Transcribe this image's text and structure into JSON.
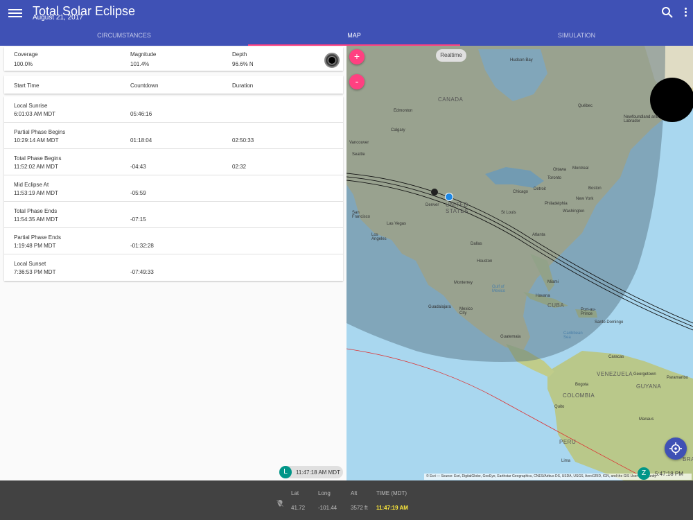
{
  "app": {
    "title": "Total Solar Eclipse",
    "subtitle": "August 21, 2017",
    "icons": {
      "menu": "menu-icon",
      "search": "search-icon",
      "more": "more-vert-icon"
    }
  },
  "tabs": [
    {
      "label": "CIRCUMSTANCES",
      "active": false
    },
    {
      "label": "MAP",
      "active": true
    },
    {
      "label": "SIMULATION",
      "active": false
    }
  ],
  "summary": {
    "coverage_label": "Coverage",
    "coverage": "100.0%",
    "magnitude_label": "Magnitude",
    "magnitude": "101.4%",
    "depth_label": "Depth",
    "depth": "96.6% N"
  },
  "table_header": {
    "start_time": "Start Time",
    "countdown": "Countdown",
    "duration": "Duration"
  },
  "events": [
    {
      "name": "Local Sunrise",
      "time": "6:01:03 AM MDT",
      "countdown": "05:46:16",
      "duration": ""
    },
    {
      "name": "Partial Phase Begins",
      "time": "10:29:14 AM MDT",
      "countdown": "01:18:04",
      "duration": "02:50:33"
    },
    {
      "name": "Total Phase Begins",
      "time": "11:52:02 AM MDT",
      "countdown": "-04:43",
      "duration": "02:32"
    },
    {
      "name": "Mid Eclipse At",
      "time": "11:53:19 AM MDT",
      "countdown": "-05:59",
      "duration": ""
    },
    {
      "name": "Total Phase Ends",
      "time": "11:54:35 AM MDT",
      "countdown": "-07:15",
      "duration": ""
    },
    {
      "name": "Partial Phase Ends",
      "time": "1:19:48 PM MDT",
      "countdown": "-01:32:28",
      "duration": ""
    },
    {
      "name": "Local Sunset",
      "time": "7:36:53 PM MDT",
      "countdown": "-07:49:33",
      "duration": ""
    }
  ],
  "local_chip": {
    "letter": "L",
    "time": "11:47:18 AM MDT"
  },
  "map": {
    "realtime_label": "Realtime",
    "zoom_in": "+",
    "zoom_out": "-",
    "z_chip": {
      "letter": "Z",
      "time": "5:47:18 PM"
    },
    "attribution": "© Esri — Source: Esri, DigitalGlobe, GeoEye, Earthstar Geographics, CNES/Airbus DS, USDA, USGS, AeroGRID, IGN, and the GIS User Community",
    "labels": {
      "hudson_bay": "Hudson Bay",
      "canada": "CANADA",
      "edmonton": "Edmonton",
      "calgary": "Calgary",
      "vancouver": "Vancouver",
      "seattle": "Seattle",
      "quebec": "Québec",
      "newfoundland": "Newfoundland and Labrador",
      "ottawa": "Ottawa",
      "montreal": "Montreal",
      "toronto": "Toronto",
      "detroit": "Detroit",
      "chicago": "Chicago",
      "boston": "Boston",
      "new_york": "New York",
      "philadelphia": "Philadelphia",
      "washington": "Washington",
      "denver": "Denver",
      "united_states": "UNITED STATES",
      "san_francisco": "San Francisco",
      "las_vegas": "Las Vegas",
      "los_angeles": "Los Angeles",
      "st_louis": "St Louis",
      "dallas": "Dallas",
      "houston": "Houston",
      "atlanta": "Atlanta",
      "miami": "Miami",
      "monterrey": "Monterrey",
      "gulf_of_mexico": "Gulf of Mexico",
      "havana": "Havana",
      "cuba": "CUBA",
      "guadalajara": "Guadalajara",
      "mexico_city": "Mexico City",
      "guatemala": "Guatemala",
      "caribbean_sea": "Caribbean Sea",
      "port_au_prince": "Port-au-Prince",
      "santo_domingo": "Santo Domingo",
      "caracas": "Caracas",
      "venezuela": "VENEZUELA",
      "georgetown": "Georgetown",
      "guyana": "GUYANA",
      "paramaribo": "Paramaribo",
      "bogota": "Bogota",
      "colombia": "COLOMBIA",
      "quito": "Quito",
      "manaus": "Manaus",
      "peru": "PERU",
      "lima": "Lima",
      "brazil": "BRAZI"
    },
    "colors": {
      "land": "#d9d2a6",
      "water": "#a9d7ef",
      "shadow": "#5a7585",
      "path": "#111111",
      "track": "#d33"
    }
  },
  "bottom": {
    "lat_label": "Lat",
    "lat": "41.72",
    "long_label": "Long",
    "long": "-101.44",
    "alt_label": "Alt",
    "alt": "3572 ft",
    "time_label": "TIME (MDT)",
    "time": "11:47:19 AM",
    "icons": {
      "location": "location-off-icon"
    }
  },
  "colors": {
    "primary": "#3f51b5",
    "accent": "#ff4081",
    "teal": "#009688",
    "highlight": "#ffeb3b"
  }
}
